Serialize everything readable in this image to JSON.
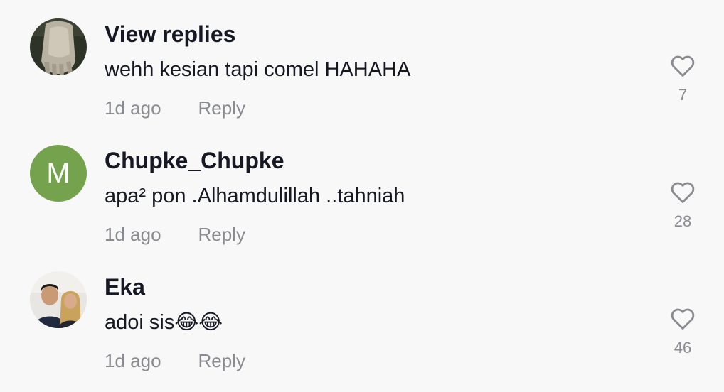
{
  "comments": [
    {
      "username": "View replies",
      "text": "wehh kesian tapi comel HAHAHA",
      "time": "1d ago",
      "reply_label": "Reply",
      "likes": "7",
      "avatar": {
        "type": "photo",
        "description_icon": "hand-photo-avatar"
      }
    },
    {
      "username": "Chupke_Chupke",
      "text": "apa² pon .Alhamdulillah ..tahniah",
      "time": "1d ago",
      "reply_label": "Reply",
      "likes": "28",
      "avatar": {
        "type": "letter",
        "letter": "M",
        "color": "#74a24d"
      }
    },
    {
      "username": "Eka",
      "text": "adoi sis😂😂",
      "time": "1d ago",
      "reply_label": "Reply",
      "likes": "46",
      "avatar": {
        "type": "photo",
        "description_icon": "couple-photo-avatar"
      }
    }
  ],
  "colors": {
    "background": "#f8f8f8",
    "username": "#161823",
    "meta": "#8a8b91",
    "heart_stroke": "#8a8b91"
  },
  "icons": {
    "like": "heart-outline-icon"
  }
}
